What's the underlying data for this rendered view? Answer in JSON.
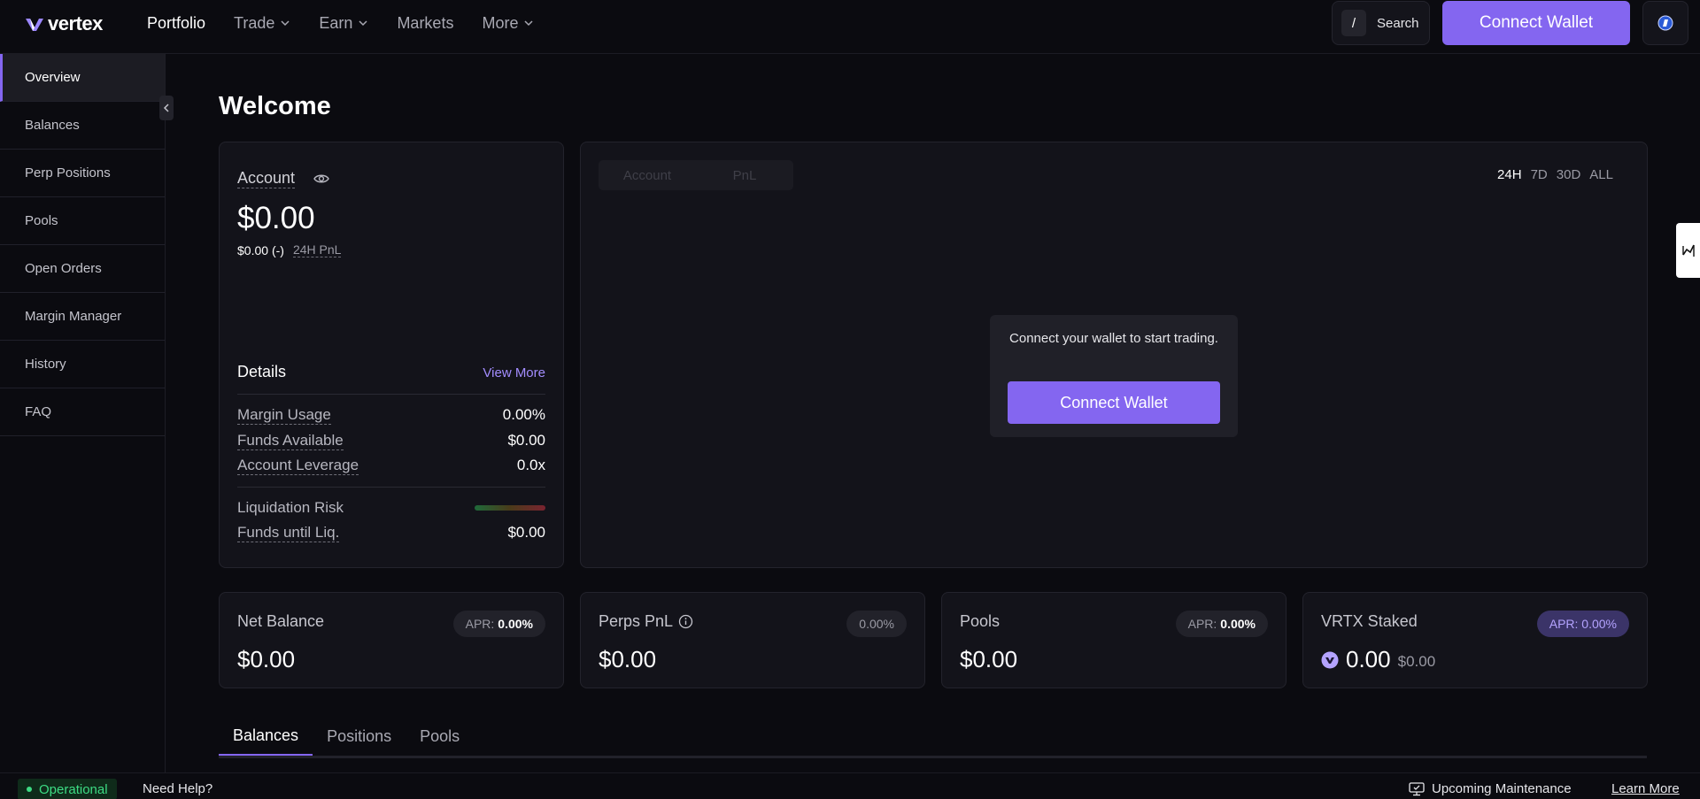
{
  "brand": {
    "name": "vertex"
  },
  "nav": [
    {
      "label": "Portfolio",
      "dropdown": false,
      "active": true
    },
    {
      "label": "Trade",
      "dropdown": true
    },
    {
      "label": "Earn",
      "dropdown": true
    },
    {
      "label": "Markets",
      "dropdown": false
    },
    {
      "label": "More",
      "dropdown": true
    }
  ],
  "search": {
    "key": "/",
    "label": "Search"
  },
  "header": {
    "connect_label": "Connect Wallet"
  },
  "sidebar": {
    "items": [
      {
        "label": "Overview",
        "active": true
      },
      {
        "label": "Balances"
      },
      {
        "label": "Perp Positions"
      },
      {
        "label": "Pools"
      },
      {
        "label": "Open Orders"
      },
      {
        "label": "Margin Manager"
      },
      {
        "label": "History"
      },
      {
        "label": "FAQ"
      }
    ]
  },
  "main": {
    "title": "Welcome",
    "account": {
      "title": "Account",
      "value": "$0.00",
      "pnl_value": "$0.00",
      "pnl_change": "(-)",
      "pnl_label": "24H PnL",
      "details_title": "Details",
      "view_more": "View More",
      "rows": [
        {
          "label": "Margin Usage",
          "value": "0.00%"
        },
        {
          "label": "Funds Available",
          "value": "$0.00"
        },
        {
          "label": "Account Leverage",
          "value": "0.0x"
        }
      ],
      "risk_label": "Liquidation Risk",
      "funds_liq_label": "Funds until Liq.",
      "funds_liq_value": "$0.00"
    },
    "chart": {
      "tabs": [
        "Account",
        "PnL"
      ],
      "ranges": [
        "24H",
        "7D",
        "30D",
        "ALL"
      ],
      "active_range": "24H",
      "connect_message": "Connect your wallet to start trading.",
      "connect_label": "Connect Wallet"
    },
    "stats": [
      {
        "title": "Net Balance",
        "value": "$0.00",
        "apr_label": "APR:",
        "apr_value": "0.00%"
      },
      {
        "title": "Perps PnL",
        "value": "$0.00",
        "badge": "0.00%"
      },
      {
        "title": "Pools",
        "value": "$0.00",
        "apr_label": "APR:",
        "apr_value": "0.00%"
      },
      {
        "title": "VRTX Staked",
        "value": "0.00",
        "sub_value": "$0.00",
        "apr_text": "APR: 0.00%"
      }
    ],
    "bottom_tabs": [
      {
        "label": "Balances",
        "active": true
      },
      {
        "label": "Positions"
      },
      {
        "label": "Pools"
      }
    ]
  },
  "footer": {
    "status": "Operational",
    "help": "Need Help?",
    "maintenance": "Upcoming Maintenance",
    "learn_more": "Learn More"
  },
  "colors": {
    "accent": "#8466f0",
    "background": "#0b0b10",
    "card": "#13131a",
    "status_green": "#3ddc84"
  },
  "icons": [
    "vertex-logo-icon",
    "chevron-down-icon",
    "chevron-left-icon",
    "eye-icon",
    "info-icon",
    "globe-icon",
    "maintenance-icon",
    "vrtx-token-icon",
    "chart-tool-icon"
  ]
}
